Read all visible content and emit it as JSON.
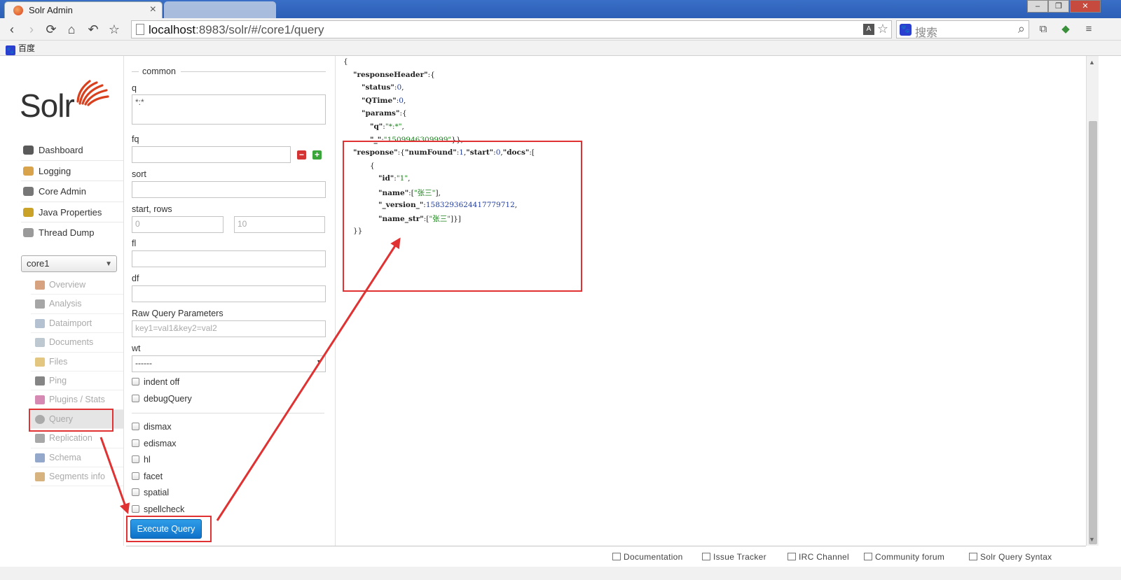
{
  "browser": {
    "active_tab_title": "Solr Admin",
    "tab_close_glyph": "×",
    "url_host": "localhost",
    "url_rest": ":8983/solr/#/core1/query",
    "search_placeholder": "搜索",
    "bookmark_label": "百度",
    "nav_back_icon": "chevron-left-icon",
    "nav_forward_icon": "chevron-right-icon",
    "reload_icon": "reload-icon",
    "home_icon": "home-icon",
    "undo_icon": "undo-icon",
    "star_icon": "star-icon"
  },
  "logo": {
    "text": "Solr"
  },
  "main_nav": [
    {
      "label": "Dashboard",
      "icon": "dashboard-icon",
      "color": "#5a5a5a"
    },
    {
      "label": "Logging",
      "icon": "logging-icon",
      "color": "#d8a34a"
    },
    {
      "label": "Core Admin",
      "icon": "core-admin-icon",
      "color": "#777777"
    },
    {
      "label": "Java Properties",
      "icon": "java-properties-icon",
      "color": "#c9a227"
    },
    {
      "label": "Thread Dump",
      "icon": "thread-dump-icon",
      "color": "#9a9a9a"
    }
  ],
  "core_selector": {
    "value": "core1"
  },
  "core_nav": [
    {
      "label": "Overview",
      "icon": "overview-icon",
      "color": "#c0703a"
    },
    {
      "label": "Analysis",
      "icon": "analysis-icon",
      "color": "#777777"
    },
    {
      "label": "Dataimport",
      "icon": "dataimport-icon",
      "color": "#8aa0b8"
    },
    {
      "label": "Documents",
      "icon": "documents-icon",
      "color": "#9aaab8"
    },
    {
      "label": "Files",
      "icon": "files-icon",
      "color": "#d4a83a"
    },
    {
      "label": "Ping",
      "icon": "ping-icon",
      "color": "#444444"
    },
    {
      "label": "Plugins / Stats",
      "icon": "plugins-icon",
      "color": "#c04a8a"
    },
    {
      "label": "Query",
      "icon": "query-icon",
      "color": "#8a8a8a"
    },
    {
      "label": "Replication",
      "icon": "replication-icon",
      "color": "#7a7a7a"
    },
    {
      "label": "Schema",
      "icon": "schema-icon",
      "color": "#5a7ab0"
    },
    {
      "label": "Segments info",
      "icon": "segments-icon",
      "color": "#c08a3a"
    }
  ],
  "query_form": {
    "legend": "common",
    "q_label": "q",
    "q_value": "*:*",
    "fq_label": "fq",
    "sort_label": "sort",
    "start_rows_label": "start, rows",
    "start_placeholder": "0",
    "rows_placeholder": "10",
    "fl_label": "fl",
    "df_label": "df",
    "raw_label": "Raw Query Parameters",
    "raw_placeholder": "key1=val1&key2=val2",
    "wt_label": "wt",
    "wt_value": "------",
    "indent_label": "indent off",
    "debug_label": "debugQuery",
    "dismax_label": "dismax",
    "edismax_label": "edismax",
    "hl_label": "hl",
    "facet_label": "facet",
    "spatial_label": "spatial",
    "spellcheck_label": "spellcheck",
    "execute_label": "Execute Query",
    "minus_glyph": "−",
    "plus_glyph": "+"
  },
  "response_lines": [
    {
      "indent": 0,
      "html": "{"
    },
    {
      "indent": 1,
      "html": "<span class='k'>\"responseHeader\"</span>:{"
    },
    {
      "indent": 2,
      "html": "<span class='k'>\"status\"</span>:<span class='n'>0</span>,"
    },
    {
      "indent": 2,
      "html": "<span class='k'>\"QTime\"</span>:<span class='n'>0</span>,"
    },
    {
      "indent": 2,
      "html": "<span class='k'>\"params\"</span>:{"
    },
    {
      "indent": 3,
      "html": "<span class='k'>\"q\"</span>:<span class='s'>\"*:*\"</span>,"
    },
    {
      "indent": 3,
      "html": "<span class='k'>\"_\"</span>:<span class='s'>\"1509946309999\"</span>}},"
    },
    {
      "indent": 1,
      "html": "<span class='k'>\"response\"</span>:{<span class='k'>\"numFound\"</span>:<span class='n'>1</span>,<span class='k'>\"start\"</span>:<span class='n'>0</span>,<span class='k'>\"docs\"</span>:["
    },
    {
      "indent": 3,
      "html": "{"
    },
    {
      "indent": 4,
      "html": "<span class='k'>\"id\"</span>:<span class='s'>\"1\"</span>,"
    },
    {
      "indent": 4,
      "html": "<span class='k'>\"name\"</span>:[<span class='s'>\"张三\"</span>],"
    },
    {
      "indent": 4,
      "html": "<span class='k'>\"_version_\"</span>:<span class='n'>1583293624417779712</span>,"
    },
    {
      "indent": 4,
      "html": "<span class='k'>\"name_str\"</span>:[<span class='s'>\"张三\"</span>]}]"
    },
    {
      "indent": 1,
      "html": "}}"
    }
  ],
  "footer": {
    "links": [
      "Documentation",
      "Issue Tracker",
      "IRC Channel",
      "Community forum",
      "Solr Query Syntax"
    ]
  },
  "annotation": {
    "color": "#e03232"
  }
}
